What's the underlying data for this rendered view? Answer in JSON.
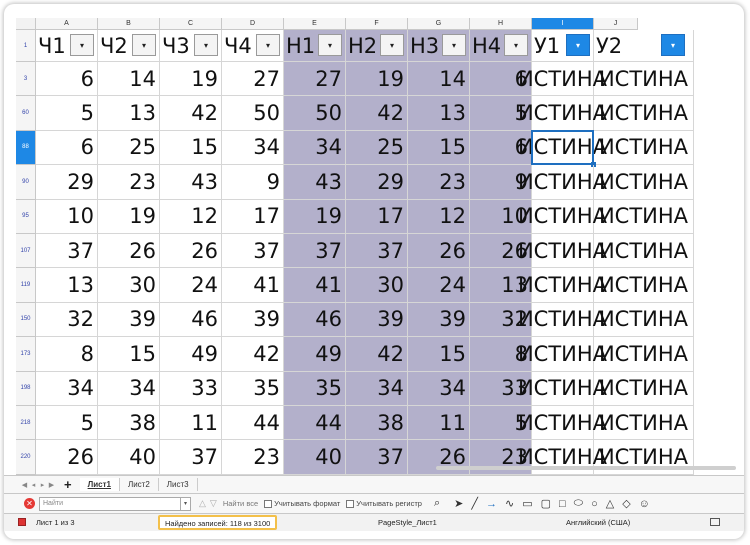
{
  "columns": [
    "A",
    "B",
    "C",
    "D",
    "E",
    "F",
    "G",
    "H",
    "I",
    "J"
  ],
  "headers": [
    "Ч1",
    "Ч2",
    "Ч3",
    "Ч4",
    "Н1",
    "Н2",
    "Н3",
    "Н4",
    "У1",
    "У2"
  ],
  "rows": [
    {
      "n": "3",
      "v": [
        "6",
        "14",
        "19",
        "27",
        "27",
        "19",
        "14",
        "6",
        "ИСТИНА",
        "ИСТИНА"
      ]
    },
    {
      "n": "60",
      "v": [
        "5",
        "13",
        "42",
        "50",
        "50",
        "42",
        "13",
        "5",
        "ИСТИНА",
        "ИСТИНА"
      ]
    },
    {
      "n": "88",
      "v": [
        "6",
        "25",
        "15",
        "34",
        "34",
        "25",
        "15",
        "6",
        "ИСТИНА",
        "ИСТИНА"
      ]
    },
    {
      "n": "90",
      "v": [
        "29",
        "23",
        "43",
        "9",
        "43",
        "29",
        "23",
        "9",
        "ИСТИНА",
        "ИСТИНА"
      ]
    },
    {
      "n": "95",
      "v": [
        "10",
        "19",
        "12",
        "17",
        "19",
        "17",
        "12",
        "10",
        "ИСТИНА",
        "ИСТИНА"
      ]
    },
    {
      "n": "107",
      "v": [
        "37",
        "26",
        "26",
        "37",
        "37",
        "37",
        "26",
        "26",
        "ИСТИНА",
        "ИСТИНА"
      ]
    },
    {
      "n": "119",
      "v": [
        "13",
        "30",
        "24",
        "41",
        "41",
        "30",
        "24",
        "13",
        "ИСТИНА",
        "ИСТИНА"
      ]
    },
    {
      "n": "150",
      "v": [
        "32",
        "39",
        "46",
        "39",
        "46",
        "39",
        "39",
        "32",
        "ИСТИНА",
        "ИСТИНА"
      ]
    },
    {
      "n": "173",
      "v": [
        "8",
        "15",
        "49",
        "42",
        "49",
        "42",
        "15",
        "8",
        "ИСТИНА",
        "ИСТИНА"
      ]
    },
    {
      "n": "198",
      "v": [
        "34",
        "34",
        "33",
        "35",
        "35",
        "34",
        "34",
        "33",
        "ИСТИНА",
        "ИСТИНА"
      ]
    },
    {
      "n": "218",
      "v": [
        "5",
        "38",
        "11",
        "44",
        "44",
        "38",
        "11",
        "5",
        "ИСТИНА",
        "ИСТИНА"
      ]
    },
    {
      "n": "220",
      "v": [
        "26",
        "40",
        "37",
        "23",
        "40",
        "37",
        "26",
        "23",
        "ИСТИНА",
        "ИСТИНА"
      ]
    }
  ],
  "header_row_number": "1",
  "selected_row": "88",
  "selected_column": "I",
  "filter_active_columns": [
    "I",
    "J"
  ],
  "sheet_tabs": [
    "Лист1",
    "Лист2",
    "Лист3"
  ],
  "active_tab": "Лист1",
  "add_tab_label": "+",
  "find": {
    "placeholder": "Найти",
    "find_all": "Найти все",
    "match_format": "Учитывать формат",
    "match_case": "Учитывать регистр"
  },
  "status": {
    "sheet": "Лист 1 из 3",
    "found": "Найдено записей: 118 из 3100",
    "page_style": "PageStyle_Лист1",
    "language": "Английский (США)"
  },
  "colors": {
    "shade": "#b3b0cb",
    "accent": "#1e88e5",
    "highlight": "#f3c04a"
  }
}
